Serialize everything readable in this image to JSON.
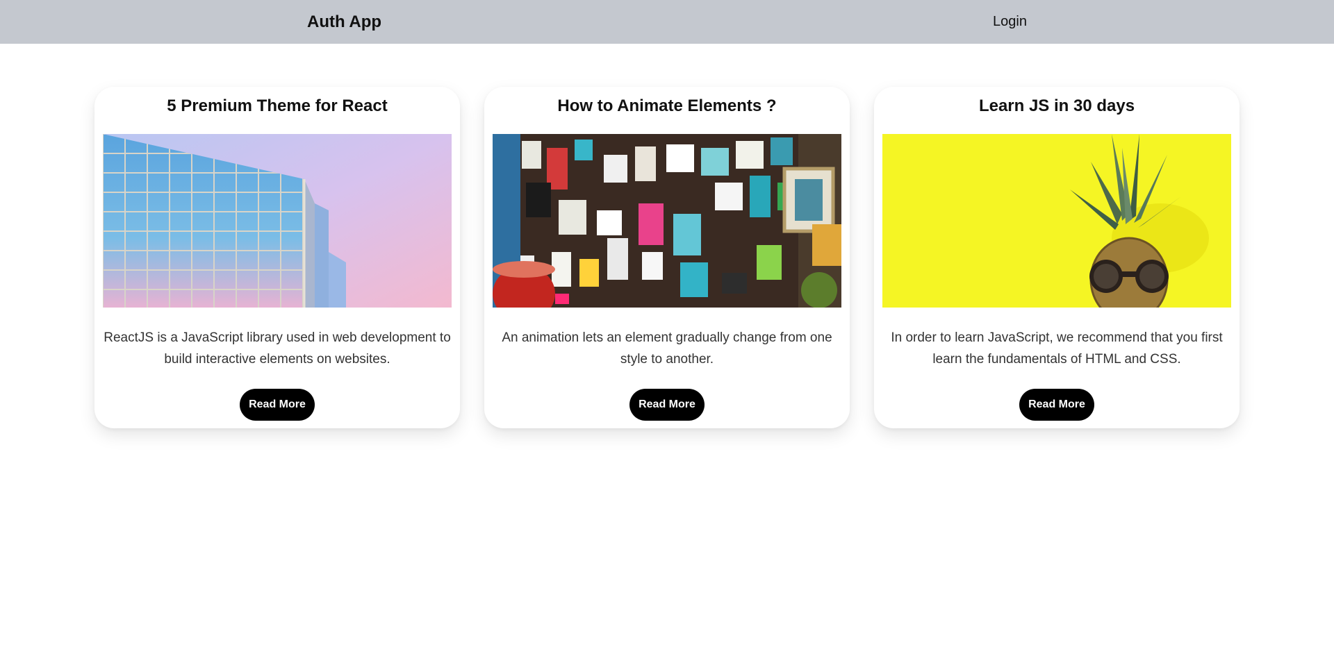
{
  "navbar": {
    "brand": "Auth App",
    "login_label": "Login"
  },
  "cards": [
    {
      "title": "5 Premium Theme for React",
      "description": "ReactJS is a JavaScript library used in web development to build interactive elements on websites.",
      "button_label": "Read More",
      "image": "glass-building-photo"
    },
    {
      "title": "How to Animate Elements ?",
      "description": "An animation lets an element gradually change from one style to another.",
      "button_label": "Read More",
      "image": "poster-wall-photo"
    },
    {
      "title": "Learn JS in 30 days",
      "description": "In order to learn JavaScript, we recommend that you first learn the fundamentals of HTML and CSS.",
      "button_label": "Read More",
      "image": "pineapple-sunglasses-photo"
    }
  ],
  "colors": {
    "navbar_bg": "#c4c8cf",
    "button_bg": "#000000",
    "button_text": "#ffffff",
    "pineapple_bg": "#f5f524"
  }
}
